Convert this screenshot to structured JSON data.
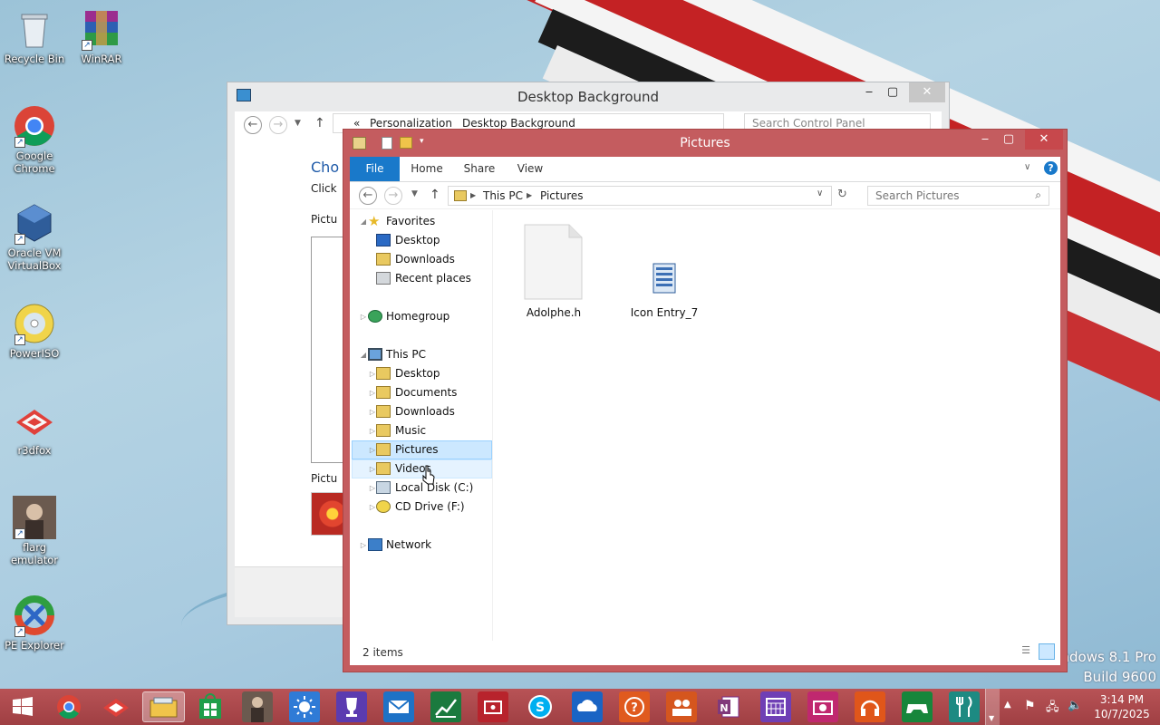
{
  "desktop": {
    "icons": [
      {
        "label": "Recycle Bin",
        "icon": "recycle-bin-icon"
      },
      {
        "label": "WinRAR",
        "icon": "winrar-icon"
      },
      {
        "label": "Google Chrome",
        "icon": "chrome-icon"
      },
      {
        "label": "Oracle VM VirtualBox",
        "icon": "virtualbox-icon"
      },
      {
        "label": "PowerISO",
        "icon": "poweriso-icon"
      },
      {
        "label": "r3dfox",
        "icon": "r3dfox-icon"
      },
      {
        "label": "flarg emulator",
        "icon": "flarg-icon"
      },
      {
        "label": "PE Explorer",
        "icon": "pe-explorer-icon"
      }
    ],
    "watermark": {
      "line1": "indows 8.1 Pro",
      "line2": "Build 9600"
    }
  },
  "background_window": {
    "title": "Desktop Background",
    "breadcrumb": [
      "«",
      "Personalization",
      "Desktop Background"
    ],
    "search_placeholder": "Search Control Panel",
    "heading": "Cho",
    "subtext": "Click",
    "picture_label_1": "Pictu",
    "picture_label_2": "Pictu"
  },
  "explorer": {
    "title": "Pictures",
    "ribbon_tabs": [
      "File",
      "Home",
      "Share",
      "View"
    ],
    "address": {
      "crumbs": [
        "This PC",
        "Pictures"
      ]
    },
    "search_placeholder": "Search Pictures",
    "nav": {
      "favorites": "Favorites",
      "fav_items": [
        "Desktop",
        "Downloads",
        "Recent places"
      ],
      "homegroup": "Homegroup",
      "this_pc": "This PC",
      "pc_items": [
        "Desktop",
        "Documents",
        "Downloads",
        "Music",
        "Pictures",
        "Videos",
        "Local Disk (C:)",
        "CD Drive (F:)"
      ],
      "network": "Network"
    },
    "files": [
      {
        "name": "Adolphe.h",
        "icon": "blank-file-icon"
      },
      {
        "name": "Icon Entry_7",
        "icon": "icon-file-icon"
      }
    ],
    "status": "2 items"
  },
  "taskbar": {
    "apps": [
      "start-icon",
      "chrome-icon",
      "r3dfox-icon",
      "file-explorer-icon",
      "store-icon",
      "flarg-icon",
      "weather-icon",
      "trophy-icon",
      "mail-icon",
      "finance-icon",
      "video-icon",
      "skype-icon",
      "onedrive-icon",
      "help-icon",
      "people-icon",
      "onenote-icon",
      "calendar-icon",
      "camera-icon",
      "music-icon",
      "games-icon",
      "food-icon"
    ],
    "time": "3:14 PM",
    "date": "10/7/2025"
  },
  "colors": {
    "accent": "#c45c5f",
    "taskbar": "#a84448",
    "file_tab": "#1979ca"
  }
}
